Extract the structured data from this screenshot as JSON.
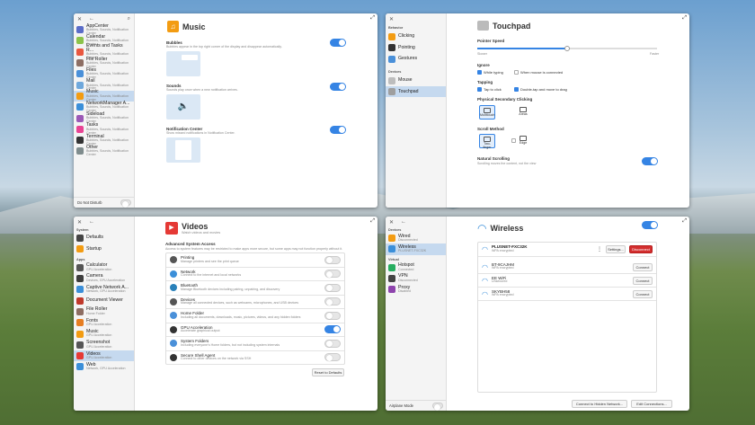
{
  "win_notifications": {
    "sidebar": [
      {
        "t": "AppCenter",
        "s": "Bubbles, Sounds, Notification Center",
        "c": "#5a6cc8"
      },
      {
        "t": "Calendar",
        "s": "Bubbles, Sounds, Notification Center",
        "c": "#8bc34a"
      },
      {
        "t": "Events and Tasks R...",
        "s": "Bubbles, Sounds, Notification Center",
        "c": "#e9573f"
      },
      {
        "t": "File Roller",
        "s": "Bubbles, Sounds, Notification Center",
        "c": "#8d6e63"
      },
      {
        "t": "Files",
        "s": "Bubbles, Sounds, Notification Center",
        "c": "#4a90d9"
      },
      {
        "t": "Mail",
        "s": "Bubbles, Sounds, Notification Center",
        "c": "#6fa8dc"
      },
      {
        "t": "Music",
        "s": "Bubbles, Sounds, Notification Center",
        "c": "#f39c12"
      },
      {
        "t": "NetworkManager A...",
        "s": "Bubbles, Sounds, Notification Center",
        "c": "#3b8fd9"
      },
      {
        "t": "Sideload",
        "s": "Bubbles, Sounds, Notification Center",
        "c": "#9b59b6"
      },
      {
        "t": "Tasks",
        "s": "Bubbles, Sounds, Notification Center",
        "c": "#e84393"
      },
      {
        "t": "Terminal",
        "s": "Bubbles, Sounds, Notification Center",
        "c": "#333333"
      },
      {
        "t": "Other",
        "s": "Bubbles, Sounds, Notification Center",
        "c": "#7f8c8d"
      }
    ],
    "dnd": "Do Not Disturb",
    "title": "Music",
    "bubbles": {
      "label": "Bubbles",
      "desc": "Bubbles appear in the top right corner of the display and disappear automatically."
    },
    "sounds": {
      "label": "Sounds",
      "desc": "Sounds play once when a new notification arrives."
    },
    "center": {
      "label": "Notification Center",
      "desc": "Show missed notifications in Notification Center."
    }
  },
  "win_touchpad": {
    "behavior_header": "Behavior",
    "devices_header": "Devices",
    "sidebar_behavior": [
      {
        "t": "Clicking",
        "c": "#f39c12"
      },
      {
        "t": "Pointing",
        "c": "#333333"
      },
      {
        "t": "Gestures",
        "c": "#4a90d9"
      }
    ],
    "sidebar_devices": [
      {
        "t": "Mouse",
        "c": "#bdbdbd"
      },
      {
        "t": "Touchpad",
        "c": "#9e9e9e"
      }
    ],
    "title": "Touchpad",
    "pointer_speed": "Pointer Speed",
    "slower": "Slower",
    "faster": "Faster",
    "ignore": "Ignore",
    "while_typing": "While typing",
    "when_mouse": "When mouse is connected",
    "tapping": "Tapping",
    "tap_to_click": "Tap to click",
    "double_tap": "Double-tap and move to drag",
    "secondary": "Physical Secondary Clicking",
    "multitouch": "Multitouch",
    "areas": "Areas",
    "scroll_method": "Scroll Method",
    "two_finger": "Two-finger",
    "edge": "Edge",
    "natural": "Natural Scrolling",
    "natural_desc": "Scrolling moves the content, not the view"
  },
  "win_apps": {
    "system_header": "System",
    "apps_header": "Apps",
    "system": [
      {
        "t": "Defaults",
        "s": "",
        "c": "#444444"
      },
      {
        "t": "Startup",
        "s": "",
        "c": "#f39c12"
      }
    ],
    "apps": [
      {
        "t": "Calculator",
        "s": "GPU Acceleration",
        "c": "#555555"
      },
      {
        "t": "Camera",
        "s": "Devices, GPU Acceleration",
        "c": "#3d3d3d"
      },
      {
        "t": "Captive Network A...",
        "s": "Network, GPU Acceleration",
        "c": "#3b8fd9"
      },
      {
        "t": "Document Viewer",
        "s": "",
        "c": "#c0392b"
      },
      {
        "t": "File Roller",
        "s": "Home Folder",
        "c": "#8d6e63"
      },
      {
        "t": "Fonts",
        "s": "GPU Acceleration",
        "c": "#e67e22"
      },
      {
        "t": "Music",
        "s": "GPU Acceleration",
        "c": "#f39c12"
      },
      {
        "t": "Screenshot",
        "s": "GPU Acceleration",
        "c": "#555555"
      },
      {
        "t": "Videos",
        "s": "GPU Acceleration",
        "c": "#e53935"
      },
      {
        "t": "Web",
        "s": "Network, GPU Acceleration",
        "c": "#3b8fd9"
      }
    ],
    "title": "Videos",
    "subtitle": "Watch videos and movies",
    "section": "Advanced System Access",
    "section_desc": "Access to system features may be restricted to make apps more secure, but some apps may not function properly without it.",
    "perms": [
      {
        "t": "Printing",
        "s": "Manage printers and see the print queue",
        "c": "#555555",
        "on": false
      },
      {
        "t": "Network",
        "s": "Connect to the internet and local networks",
        "c": "#3b8fd9",
        "on": false
      },
      {
        "t": "Bluetooth",
        "s": "Manage Bluetooth devices including pairing, unpairing, and discovery",
        "c": "#2980b9",
        "on": false
      },
      {
        "t": "Devices",
        "s": "Manage all connected devices, such as webcams, microphones, and USB devices",
        "c": "#555555",
        "on": false
      },
      {
        "t": "Home Folder",
        "s": "Including all documents, downloads, music, pictures, videos, and any hidden folders",
        "c": "#4a90d9",
        "on": false
      },
      {
        "t": "GPU Acceleration",
        "s": "Accelerate graphical output",
        "c": "#333333",
        "on": true
      },
      {
        "t": "System Folders",
        "s": "Including everyone's Home folders, but not including system internals",
        "c": "#4a90d9",
        "on": false
      },
      {
        "t": "Secure Shell Agent",
        "s": "Connect to other devices on the network via SSH",
        "c": "#333333",
        "on": false
      }
    ],
    "reset": "Reset to Defaults"
  },
  "win_network": {
    "devices_header": "Devices",
    "virtual_header": "Virtual",
    "devices": [
      {
        "t": "Wired",
        "s": "Disconnected",
        "c": "#f39c12"
      },
      {
        "t": "Wireless",
        "s": "PLUSNET-FXC32K",
        "c": "#3b8fd9"
      }
    ],
    "virtual": [
      {
        "t": "Hotspot",
        "s": "Connected",
        "c": "#27ae60"
      },
      {
        "t": "VPN",
        "s": "Disconnected",
        "c": "#444444"
      },
      {
        "t": "Proxy",
        "s": "Disabled",
        "c": "#8e44ad"
      }
    ],
    "airplane": "Airplane Mode",
    "title": "Wireless",
    "active": {
      "name": "PLUSNET-FXC32K",
      "sec": "WPA encrypted",
      "settings": "Settings...",
      "disconnect": "Disconnect"
    },
    "networks": [
      {
        "name": "BT-9CAJHM",
        "sec": "WPA encrypted",
        "btn": "Connect"
      },
      {
        "name": "EE WiFi",
        "sec": "Unsecured",
        "btn": "Connect"
      },
      {
        "name": "SKYBH58",
        "sec": "WPA encrypted",
        "btn": "Connect"
      }
    ],
    "hidden": "Connect to Hidden Network...",
    "edit": "Edit Connections..."
  }
}
